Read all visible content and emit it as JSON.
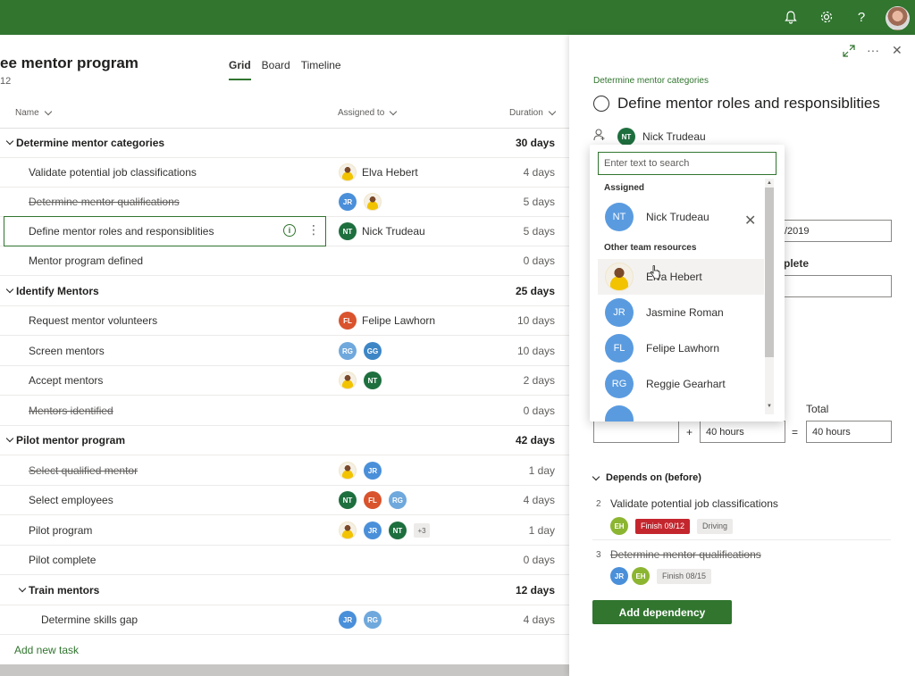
{
  "topbar": {
    "bell_icon": "bell-icon",
    "gear_icon": "gear-icon",
    "help_icon": "?"
  },
  "plan": {
    "title": "ee mentor program",
    "subtitle": "12",
    "views": [
      "Grid",
      "Board",
      "Timeline"
    ]
  },
  "columns": {
    "name": "Name",
    "assigned": "Assigned to",
    "duration": "Duration"
  },
  "rows": [
    {
      "name": "Determine mentor categories",
      "duration": "30 days",
      "group": true
    },
    {
      "name": "Validate potential job classifications",
      "duration": "4 days",
      "assignee_name": "Elva Hebert"
    },
    {
      "name": "Determine mentor qualifications",
      "duration": "5 days",
      "strike": true
    },
    {
      "name": "Define mentor roles and responsiblities",
      "duration": "5 days",
      "assignee_name": "Nick Trudeau"
    },
    {
      "name": "Mentor program defined",
      "duration": "0 days"
    },
    {
      "name": "Identify Mentors",
      "duration": "25 days",
      "group": true
    },
    {
      "name": "Request mentor volunteers",
      "duration": "10 days",
      "assignee_name": "Felipe Lawhorn"
    },
    {
      "name": "Screen mentors",
      "duration": "10 days"
    },
    {
      "name": "Accept mentors",
      "duration": "2 days"
    },
    {
      "name": "Mentors identified",
      "duration": "0 days",
      "strike": true
    },
    {
      "name": "Pilot mentor program",
      "duration": "42 days",
      "group": true
    },
    {
      "name": "Select qualified mentor",
      "duration": "1 day",
      "strike": true
    },
    {
      "name": "Select employees",
      "duration": "4 days"
    },
    {
      "name": "Pilot program",
      "duration": "1 day"
    },
    {
      "name": "Pilot complete",
      "duration": "0 days"
    },
    {
      "name": "Train mentors",
      "duration": "12 days",
      "group": true
    },
    {
      "name": "Determine skills gap",
      "duration": "4 days"
    }
  ],
  "initials": {
    "jr": "JR",
    "nt": "NT",
    "fl": "FL",
    "rg": "RG",
    "gg": "GG",
    "eh": "EH",
    "more": "+3"
  },
  "colors": {
    "brand_green": "#31752f",
    "jr": "#4a8fd9",
    "nt": "#1e6f3e",
    "fl": "#d9532c",
    "rg": "#6fa8dc",
    "gg": "#3d86c6",
    "eh": "#8cb531",
    "dd_blue": "#5a9be0"
  },
  "add_task": "Add new task",
  "panel": {
    "breadcrumb": "Determine mentor categories",
    "title": "Define mentor roles and responsiblities",
    "assigned_name": "Nick Trudeau",
    "date_fragment": "/2019",
    "complete_label": "plete",
    "total_label": "Total",
    "hours1": "",
    "hours2": "40 hours",
    "hours3": "40 hours",
    "plus": "+",
    "equals": "=",
    "depends_label": "Depends on (before)",
    "dep1_num": "2",
    "dep1_name": "Validate potential job classifications",
    "dep1_badge": "Finish 09/12",
    "dep1_tag": "Driving",
    "dep2_num": "3",
    "dep2_name": "Determine mentor qualifications",
    "dep2_badge": "Finish 08/15",
    "add_dependency": "Add dependency"
  },
  "dropdown": {
    "search_placeholder": "Enter text to search",
    "assigned_header": "Assigned",
    "others_header": "Other team resources",
    "assigned": [
      {
        "name": "Nick Trudeau",
        "initials": "NT"
      }
    ],
    "others": [
      {
        "name": "Elva Hebert",
        "initials": ""
      },
      {
        "name": "Jasmine Roman",
        "initials": "JR"
      },
      {
        "name": "Felipe Lawhorn",
        "initials": "FL"
      },
      {
        "name": "Reggie Gearhart",
        "initials": "RG"
      }
    ]
  }
}
